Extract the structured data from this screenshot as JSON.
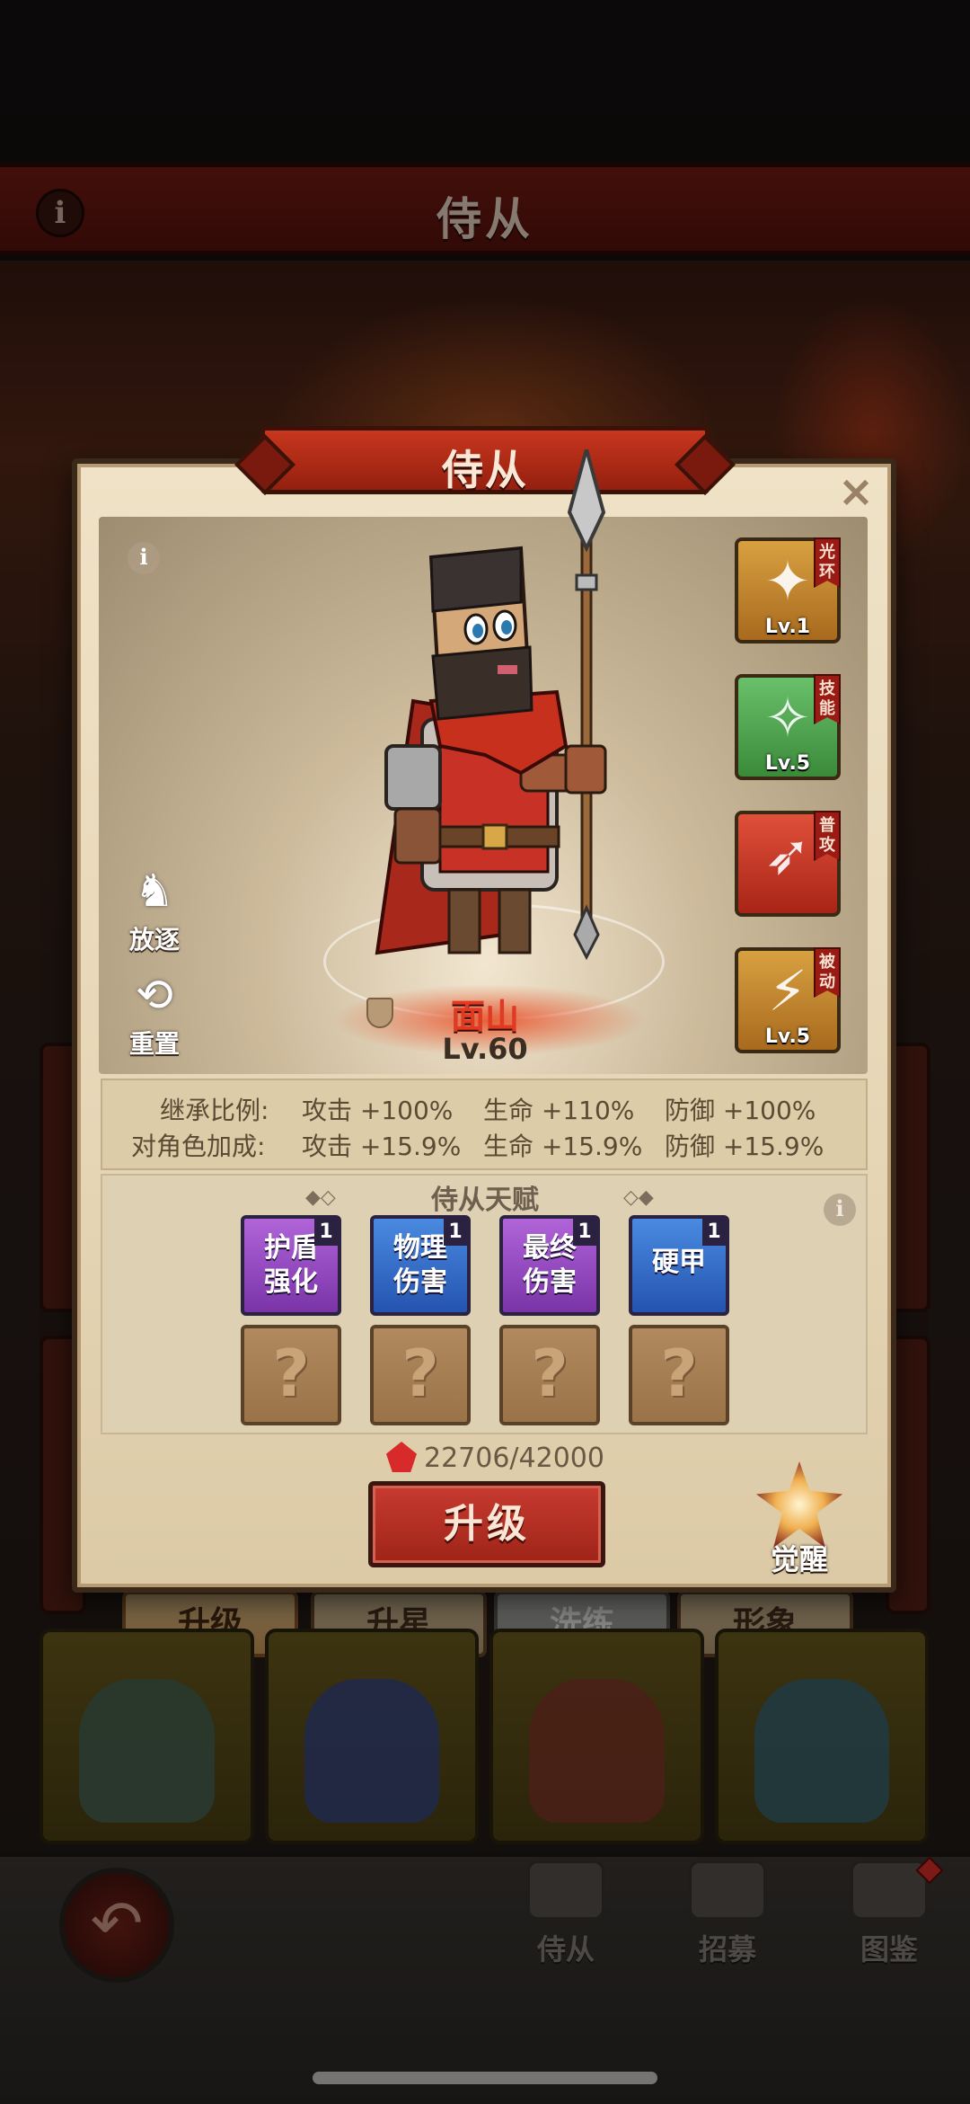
{
  "header": {
    "title": "侍从"
  },
  "modal": {
    "title": "侍从",
    "close": "×",
    "hero": {
      "name": "面山",
      "level": "Lv.60"
    },
    "side_actions": [
      {
        "label": "放逐",
        "icon": "horse-icon"
      },
      {
        "label": "重置",
        "icon": "reset-icon"
      }
    ],
    "skills": [
      {
        "tag": "光环",
        "level": "Lv.1",
        "icon": "aura-skill-icon",
        "color": "#c48a2a"
      },
      {
        "tag": "技能",
        "level": "Lv.5",
        "icon": "active-skill-icon",
        "color": "#4a9a4a"
      },
      {
        "tag": "普攻",
        "level": "",
        "icon": "attack-skill-icon",
        "color": "#c83a24"
      },
      {
        "tag": "被动",
        "level": "Lv.5",
        "icon": "passive-skill-icon",
        "color": "#c48a2a"
      }
    ],
    "stats": {
      "inherit_label": "继承比例:",
      "inherit": [
        "攻击 +100%",
        "生命 +110%",
        "防御 +100%"
      ],
      "bonus_label": "对角色加成:",
      "bonus": [
        "攻击 +15.9%",
        "生命 +15.9%",
        "防御 +15.9%"
      ]
    },
    "talents": {
      "title": "侍从天赋",
      "items": [
        {
          "name": "护盾强化",
          "line1": "护盾",
          "line2": "强化",
          "count": "1",
          "color": "purple"
        },
        {
          "name": "物理伤害",
          "line1": "物理",
          "line2": "伤害",
          "count": "1",
          "color": "blue"
        },
        {
          "name": "最终伤害",
          "line1": "最终",
          "line2": "伤害",
          "count": "1",
          "color": "purple"
        },
        {
          "name": "硬甲",
          "line1": "硬甲",
          "line2": "",
          "count": "1",
          "color": "blue"
        }
      ],
      "locked": [
        "?",
        "?",
        "?",
        "?"
      ]
    },
    "cost": "22706/42000",
    "upgrade_label": "升级",
    "awaken_label": "觉醒"
  },
  "tabs": [
    {
      "label": "升级",
      "state": "active"
    },
    {
      "label": "升星",
      "state": "normal"
    },
    {
      "label": "洗练",
      "state": "disabled"
    },
    {
      "label": "形象",
      "state": "normal"
    }
  ],
  "bottom_nav": [
    {
      "label": "侍从",
      "icon": "helmet-icon"
    },
    {
      "label": "招募",
      "icon": "flag-icon"
    },
    {
      "label": "图鉴",
      "icon": "book-icon"
    }
  ]
}
